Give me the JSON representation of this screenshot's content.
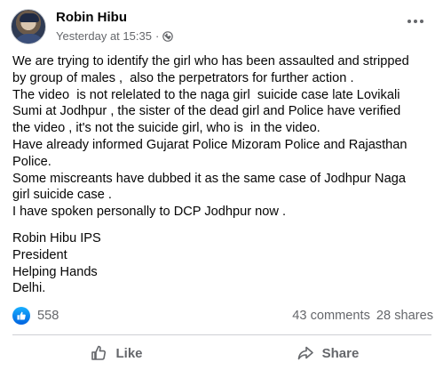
{
  "post": {
    "author": "Robin Hibu",
    "timestamp": "Yesterday at 15:35",
    "separator": "·",
    "privacy_icon": "globe-icon",
    "menu_icon": "more-options-icon",
    "body_lines": [
      "We are trying to identify the girl who has been assaulted and stripped",
      "by group of males ,  also the perpetrators for further action .",
      "The video  is not relelated to the naga girl  suicide case late Lovikali",
      "Sumi at Jodhpur , the sister of the dead girl and Police have verified",
      "the video , it's not the suicide girl, who is  in the video.",
      "Have already informed Gujarat Police Mizoram Police and Rajasthan",
      "Police.",
      "Some miscreants have dubbed it as the same case of Jodhpur Naga",
      "girl suicide case .",
      "I have spoken personally to DCP Jodhpur now ."
    ],
    "signature_lines": [
      "Robin Hibu IPS",
      "President",
      "Helping Hands",
      "Delhi."
    ]
  },
  "stats": {
    "reaction_icon": "like-reaction-icon",
    "reaction_count": "558",
    "comments": "43 comments",
    "shares": "28 shares"
  },
  "actions": {
    "like_label": "Like",
    "share_label": "Share"
  },
  "colors": {
    "text_primary": "#050505",
    "text_secondary": "#65676b",
    "like_blue": "#1877f2",
    "divider": "#ced0d4"
  }
}
